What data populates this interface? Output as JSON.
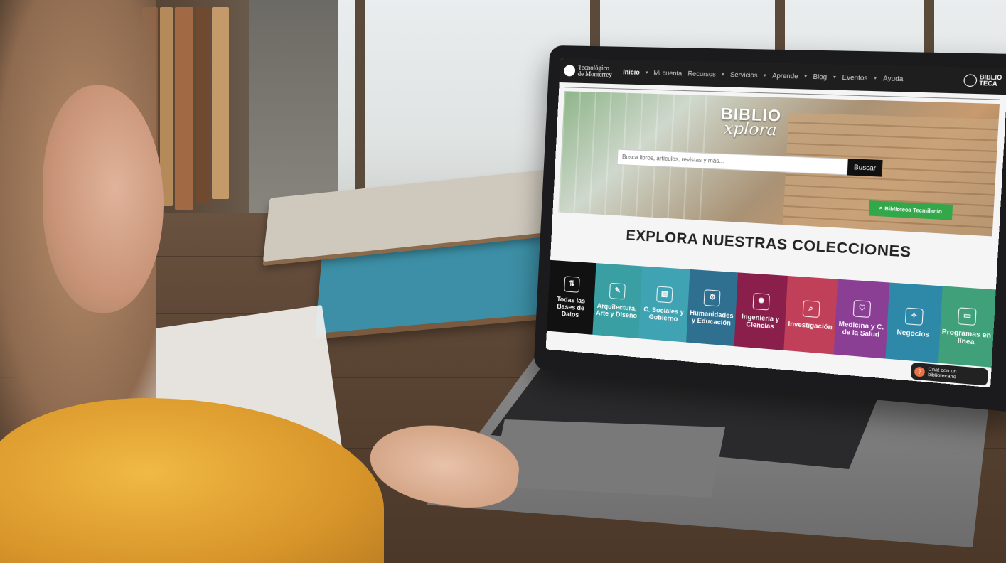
{
  "navbar": {
    "logo_line1": "Tecnológico",
    "logo_line2": "de Monterrey",
    "items": [
      {
        "label": "Inicio",
        "active": true
      },
      {
        "label": "Mi cuenta"
      },
      {
        "label": "Recursos"
      },
      {
        "label": "Servicios"
      },
      {
        "label": "Aprende"
      },
      {
        "label": "Blog"
      },
      {
        "label": "Eventos"
      },
      {
        "label": "Ayuda"
      }
    ],
    "biblio_logo": "BIBLIO TECA"
  },
  "hero": {
    "title_line1": "BIBLIO",
    "title_line2": "xplora",
    "search_placeholder": "Busca libros, artículos, revistas y más...",
    "search_button": "Buscar",
    "tecmilenio_button": "Biblioteca Tecmilenio"
  },
  "section_title": "EXPLORA NUESTRAS COLECCIONES",
  "tiles": [
    {
      "label": "Todas las Bases de Datos",
      "color": "#111111",
      "icon": "az-sort-icon"
    },
    {
      "label": "Arquitectura, Arte y Diseño",
      "color": "#3a9fa3",
      "icon": "drafting-icon"
    },
    {
      "label": "C. Sociales y Gobierno",
      "color": "#3fa3b3",
      "icon": "document-icon"
    },
    {
      "label": "Humanidades y Educación",
      "color": "#2f6f8f",
      "icon": "head-gear-icon"
    },
    {
      "label": "Ingeniería y Ciencias",
      "color": "#8a1f4c",
      "icon": "brain-icon"
    },
    {
      "label": "Investigación",
      "color": "#c0405a",
      "icon": "magnifier-icon"
    },
    {
      "label": "Medicina y C. de la Salud",
      "color": "#8a3f95",
      "icon": "heartbeat-icon"
    },
    {
      "label": "Negocios",
      "color": "#2e88a8",
      "icon": "lightbulb-icon"
    },
    {
      "label": "Programas en línea",
      "color": "#3fa07a",
      "icon": "laptop-book-icon"
    }
  ],
  "chat": {
    "label": "Chat con un bibliotecario"
  }
}
